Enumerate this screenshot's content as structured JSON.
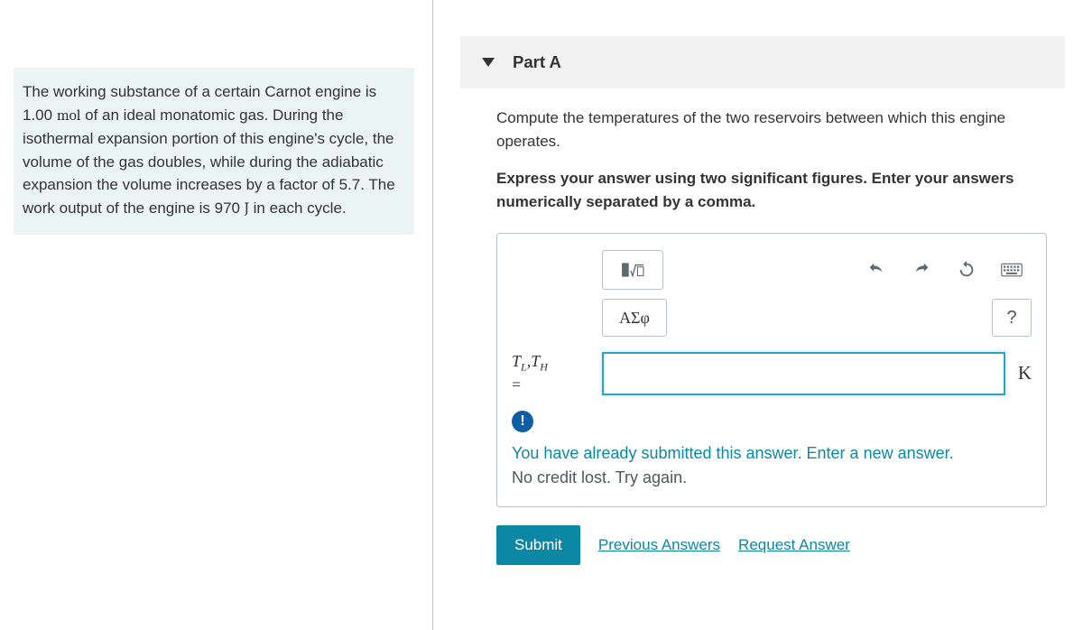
{
  "problem": {
    "text_1": "The working substance of a certain Carnot engine is 1.00 ",
    "unit_mol": "mol",
    "text_2": " of an ideal monatomic gas. During the isothermal expansion portion of this engine's cycle, the volume of the gas doubles, while during the adiabatic expansion the volume increases by a factor of 5.7. The work output of the engine is 970 ",
    "unit_J": "J",
    "text_3": " in each cycle."
  },
  "part": {
    "label": "Part A",
    "question": "Compute the temperatures of the two reservoirs between which this engine operates.",
    "instruction": "Express your answer using two significant figures. Enter your answers numerically separated by a comma.",
    "var_label_html": "T<sub>L</sub>,T<sub>H</sub>",
    "var_TL": "T",
    "var_L": "L",
    "var_comma": ",",
    "var_TH": "T",
    "var_H": "H",
    "equals": "=",
    "greek": "ΑΣφ",
    "help": "?",
    "bang": "!",
    "unit": "K",
    "input_value": "",
    "feedback_main": "You have already submitted this answer. Enter a new answer.",
    "feedback_sub": "No credit lost. Try again.",
    "submit": "Submit",
    "previous": "Previous Answers",
    "request": "Request Answer"
  }
}
